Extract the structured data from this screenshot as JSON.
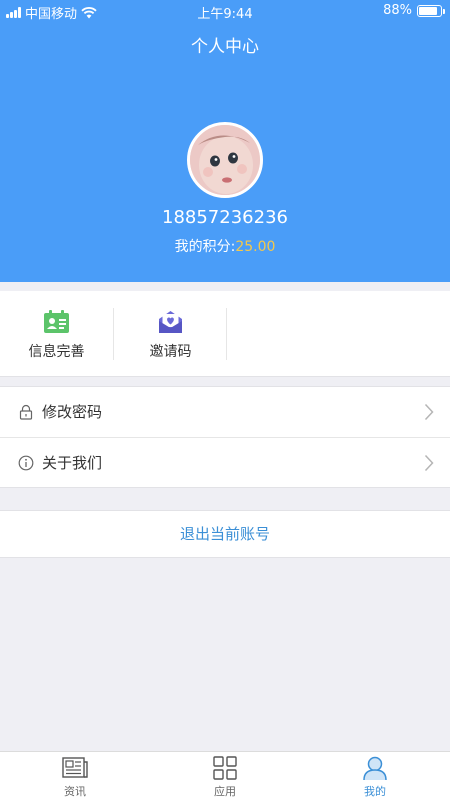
{
  "status_bar": {
    "carrier": "中国移动",
    "time": "上午9:44",
    "battery": "88%",
    "battery_level": 0.88
  },
  "header": {
    "title": "个人中心",
    "phone": "18857236236",
    "points_label": "我的积分:",
    "points_value": "25.00"
  },
  "quick_actions": [
    {
      "label": "信息完善",
      "icon": "id-card-icon",
      "color": "#5cc46a"
    },
    {
      "label": "邀请码",
      "icon": "envelope-heart-icon",
      "color": "#6b6ad8"
    }
  ],
  "menu": [
    {
      "label": "修改密码",
      "icon": "lock-icon"
    },
    {
      "label": "关于我们",
      "icon": "info-icon"
    }
  ],
  "logout_label": "退出当前账号",
  "tabs": [
    {
      "label": "资讯",
      "icon": "news-icon",
      "active": false
    },
    {
      "label": "应用",
      "icon": "apps-grid-icon",
      "active": false
    },
    {
      "label": "我的",
      "icon": "user-icon",
      "active": true
    }
  ],
  "colors": {
    "header_bg": "#4a9df8",
    "points_value": "#f5c84a",
    "accent": "#3b8fd6"
  }
}
